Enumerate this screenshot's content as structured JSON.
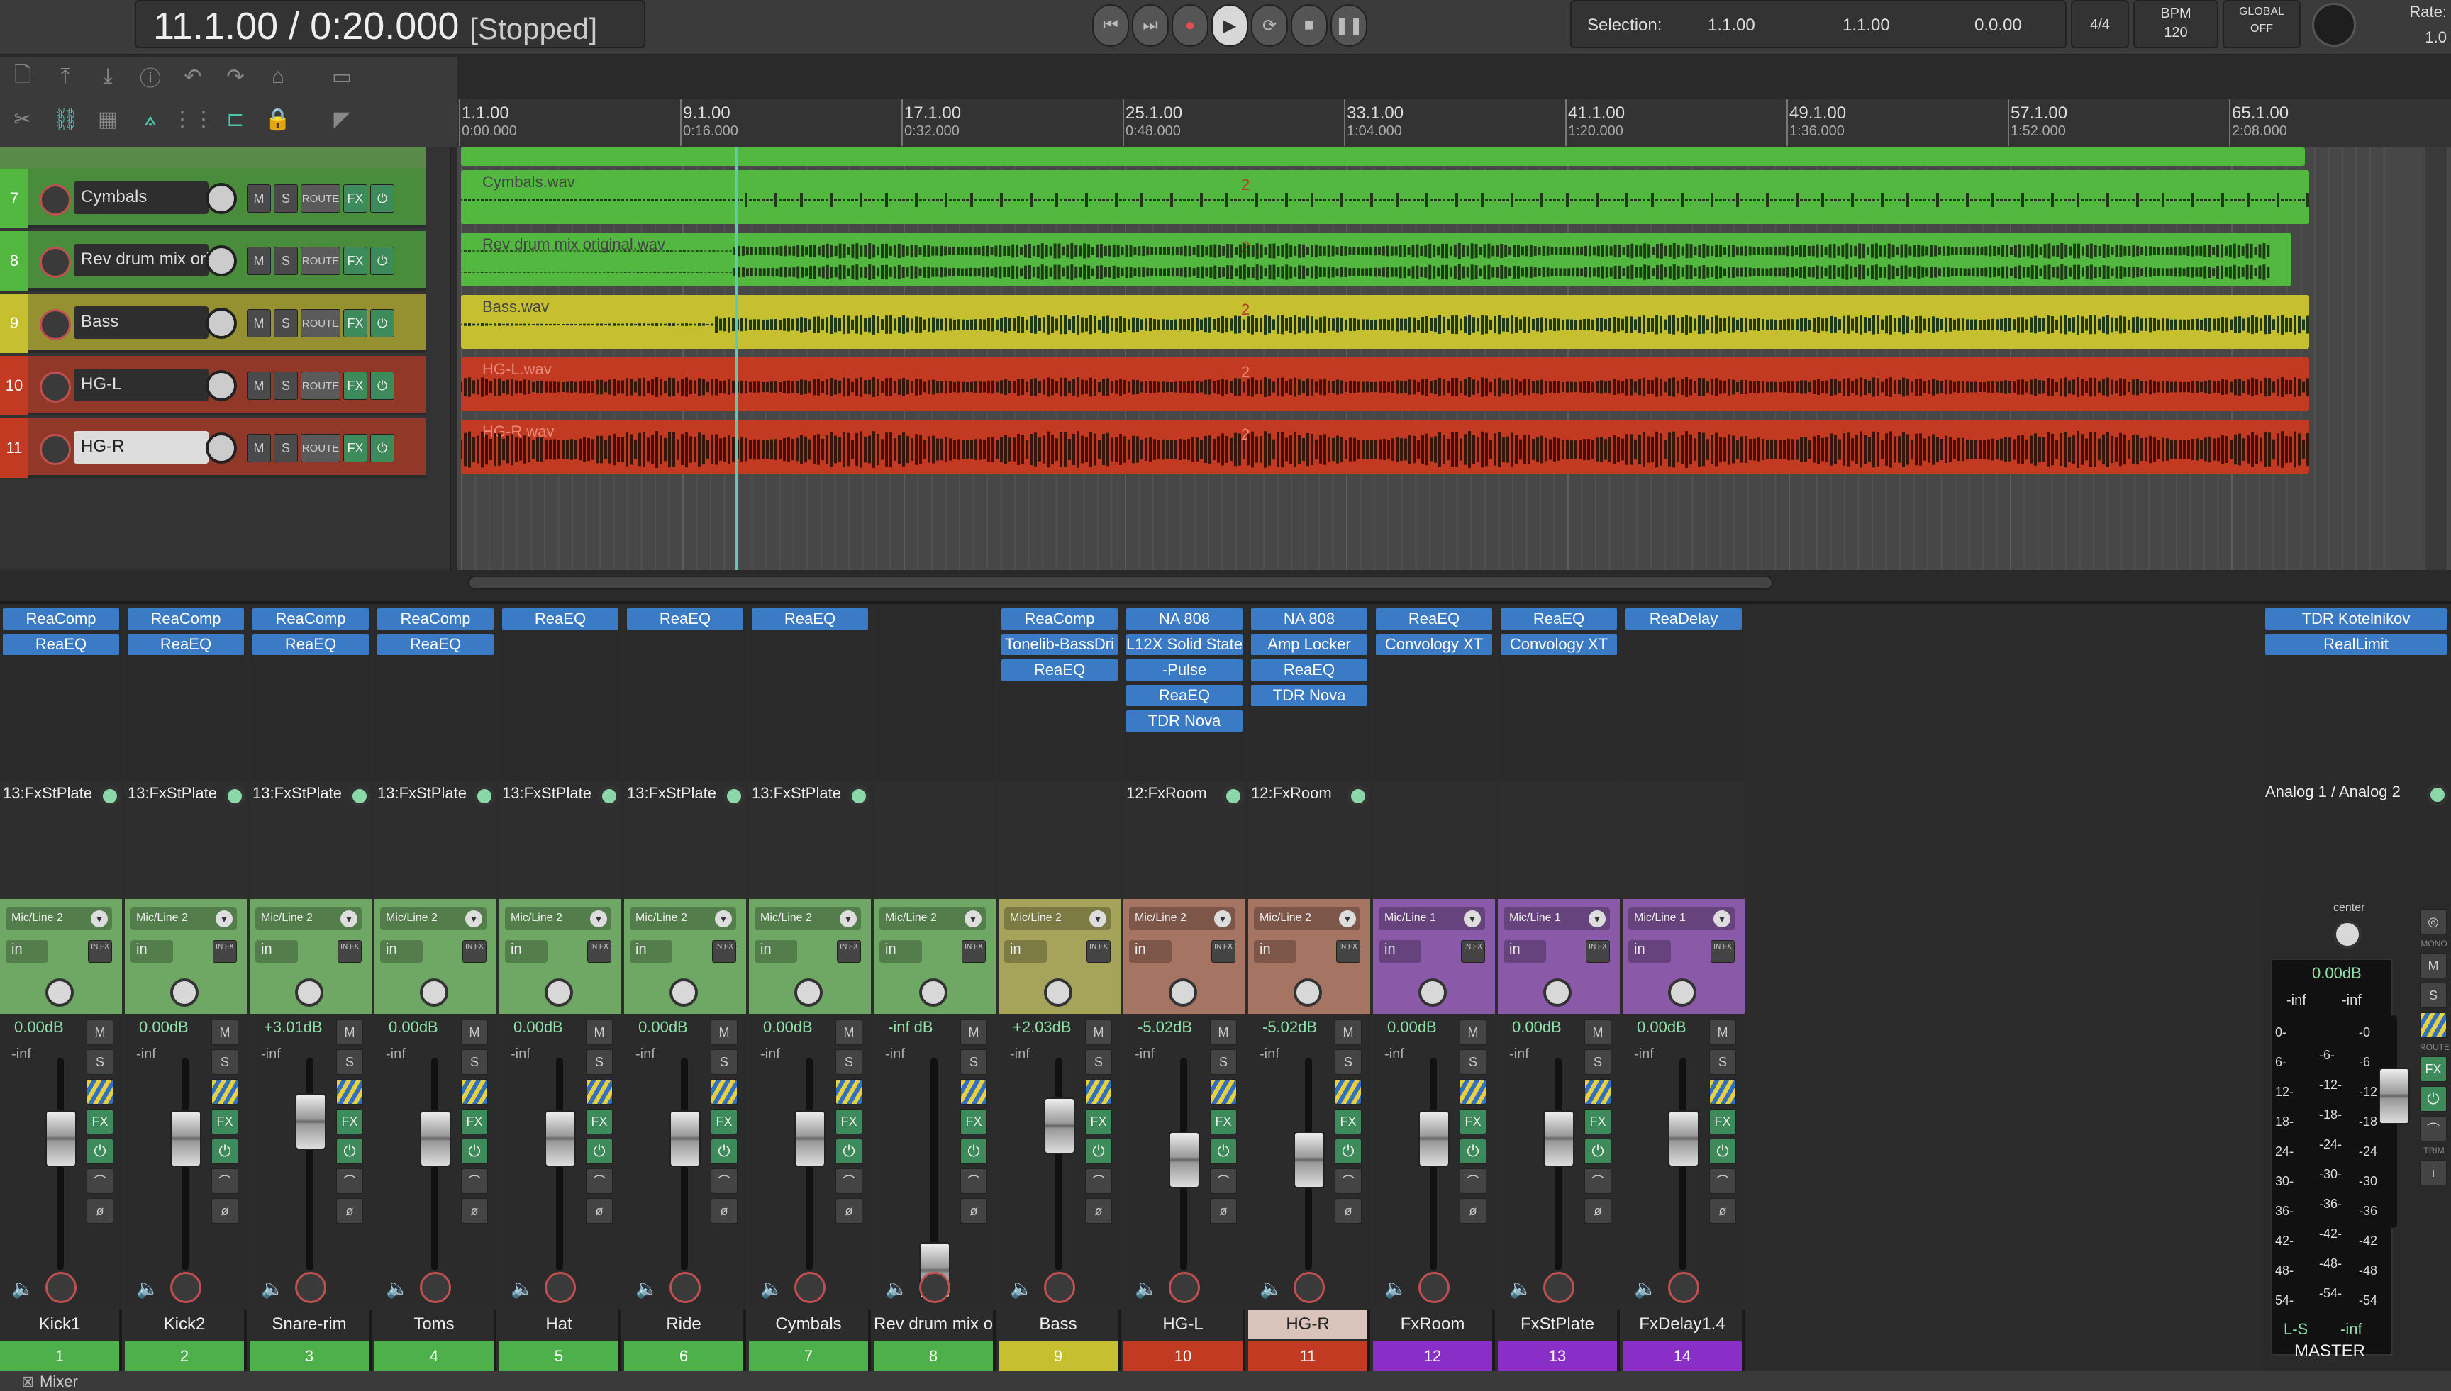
{
  "transport": {
    "position": "11.1.00 / 0:20.000",
    "state": "[Stopped]"
  },
  "selection": {
    "label": "Selection:",
    "start": "1.1.00",
    "end": "1.1.00",
    "length": "0.0.00"
  },
  "timesig": "4/4",
  "bpm": {
    "label": "BPM",
    "value": "120"
  },
  "global": {
    "label": "GLOBAL",
    "value": "OFF"
  },
  "rate": {
    "label": "Rate:",
    "value": "1.0"
  },
  "ruler": [
    {
      "bar": "1.1.00",
      "time": "0:00.000"
    },
    {
      "bar": "9.1.00",
      "time": "0:16.000"
    },
    {
      "bar": "17.1.00",
      "time": "0:32.000"
    },
    {
      "bar": "25.1.00",
      "time": "0:48.000"
    },
    {
      "bar": "33.1.00",
      "time": "1:04.000"
    },
    {
      "bar": "41.1.00",
      "time": "1:20.000"
    },
    {
      "bar": "49.1.00",
      "time": "1:36.000"
    },
    {
      "bar": "57.1.00",
      "time": "1:52.000"
    },
    {
      "bar": "65.1.00",
      "time": "2:08.000"
    }
  ],
  "tracks": [
    {
      "num": "7",
      "name": "Cymbals",
      "color": "#52b840",
      "item": "Cymbals.wav"
    },
    {
      "num": "8",
      "name": "Rev drum mix ori",
      "color": "#52b840",
      "item": "Rev drum mix original.wav"
    },
    {
      "num": "9",
      "name": "Bass",
      "color": "#c6c030",
      "item": "Bass.wav"
    },
    {
      "num": "10",
      "name": "HG-L",
      "color": "#c23a22",
      "item": "HG-L.wav"
    },
    {
      "num": "11",
      "name": "HG-R",
      "color": "#c23a22",
      "item": "HG-R.wav"
    }
  ],
  "track_buttons": {
    "mute": "M",
    "solo": "S",
    "route": "ROUTE",
    "fx": "FX",
    "power": "⏻"
  },
  "item_marker": "2",
  "mixer": {
    "label": "Mixer",
    "strip_buttons": {
      "mute": "M",
      "solo": "S",
      "fx": "FX",
      "in": "in",
      "infx": "IN FX"
    },
    "strips": [
      {
        "name": "Kick1",
        "num": "1",
        "color": "#4eb04a",
        "io_color": "#6fa864",
        "fx": [
          "ReaComp",
          "ReaEQ"
        ],
        "send": "13:FxStPlate",
        "input": "Mic/Line 2",
        "vol": "0.00dB",
        "peak": "-inf",
        "fader": 0.62
      },
      {
        "name": "Kick2",
        "num": "2",
        "color": "#4eb04a",
        "io_color": "#6fa864",
        "fx": [
          "ReaComp",
          "ReaEQ"
        ],
        "send": "13:FxStPlate",
        "input": "Mic/Line 2",
        "vol": "0.00dB",
        "peak": "-inf",
        "fader": 0.62
      },
      {
        "name": "Snare-rim",
        "num": "3",
        "color": "#4eb04a",
        "io_color": "#6fa864",
        "fx": [
          "ReaComp",
          "ReaEQ"
        ],
        "send": "13:FxStPlate",
        "input": "Mic/Line 2",
        "vol": "+3.01dB",
        "peak": "-inf",
        "fader": 0.7
      },
      {
        "name": "Toms",
        "num": "4",
        "color": "#4eb04a",
        "io_color": "#6fa864",
        "fx": [
          "ReaComp",
          "ReaEQ"
        ],
        "send": "13:FxStPlate",
        "input": "Mic/Line 2",
        "vol": "0.00dB",
        "peak": "-inf",
        "fader": 0.62
      },
      {
        "name": "Hat",
        "num": "5",
        "color": "#4eb04a",
        "io_color": "#6fa864",
        "fx": [
          "ReaEQ"
        ],
        "send": "13:FxStPlate",
        "input": "Mic/Line 2",
        "vol": "0.00dB",
        "peak": "-inf",
        "fader": 0.62
      },
      {
        "name": "Ride",
        "num": "6",
        "color": "#4eb04a",
        "io_color": "#6fa864",
        "fx": [
          "ReaEQ"
        ],
        "send": "13:FxStPlate",
        "input": "Mic/Line 2",
        "vol": "0.00dB",
        "peak": "-inf",
        "fader": 0.62
      },
      {
        "name": "Cymbals",
        "num": "7",
        "color": "#4eb04a",
        "io_color": "#6fa864",
        "fx": [
          "ReaEQ"
        ],
        "send": "13:FxStPlate",
        "input": "Mic/Line 2",
        "vol": "0.00dB",
        "peak": "-inf",
        "fader": 0.62
      },
      {
        "name": "Rev drum mix o",
        "num": "8",
        "color": "#4eb04a",
        "io_color": "#6fa864",
        "fx": [],
        "send": "",
        "input": "Mic/Line 2",
        "vol": "-inf dB",
        "peak": "-inf",
        "fader": 0.0
      },
      {
        "name": "Bass",
        "num": "9",
        "color": "#c6c030",
        "io_color": "#a6a45a",
        "fx": [
          "ReaComp",
          "Tonelib-BassDri",
          "ReaEQ"
        ],
        "send": "",
        "input": "Mic/Line 2",
        "vol": "+2.03dB",
        "peak": "-inf",
        "fader": 0.68
      },
      {
        "name": "HG-L",
        "num": "10",
        "color": "#c23a22",
        "io_color": "#a67462",
        "fx": [
          "NA 808",
          "L12X Solid State",
          "-Pulse",
          "ReaEQ",
          "TDR Nova"
        ],
        "send": "12:FxRoom",
        "input": "Mic/Line 2",
        "vol": "-5.02dB",
        "peak": "-inf",
        "fader": 0.52
      },
      {
        "name": "HG-R",
        "num": "11",
        "color": "#c23a22",
        "io_color": "#a67462",
        "fx": [
          "NA 808",
          "Amp Locker",
          "ReaEQ",
          "TDR Nova"
        ],
        "send": "12:FxRoom",
        "input": "Mic/Line 2",
        "vol": "-5.02dB",
        "peak": "-inf",
        "fader": 0.52,
        "selected": true
      },
      {
        "name": "FxRoom",
        "num": "12",
        "color": "#8a2ec8",
        "io_color": "#8a5aa8",
        "fx": [
          "ReaEQ",
          "Convology XT"
        ],
        "send": "",
        "input": "Mic/Line 1",
        "vol": "0.00dB",
        "peak": "-inf",
        "fader": 0.62
      },
      {
        "name": "FxStPlate",
        "num": "13",
        "color": "#8a2ec8",
        "io_color": "#8a5aa8",
        "fx": [
          "ReaEQ",
          "Convology XT"
        ],
        "send": "",
        "input": "Mic/Line 1",
        "vol": "0.00dB",
        "peak": "-inf",
        "fader": 0.62
      },
      {
        "name": "FxDelay1.4",
        "num": "14",
        "color": "#8a2ec8",
        "io_color": "#8a5aa8",
        "fx": [
          "ReaDelay"
        ],
        "send": "",
        "input": "Mic/Line 1",
        "vol": "0.00dB",
        "peak": "-inf",
        "fader": 0.62
      }
    ],
    "master": {
      "name": "MASTER",
      "fx": [
        "TDR Kotelnikov",
        "RealLimit"
      ],
      "output": "Analog 1 / Analog 2",
      "pan": "center",
      "vol": "0.00dB",
      "peakL": "-inf",
      "peakR": "-inf",
      "scale": [
        "0-",
        "6-",
        "12-",
        "18-",
        "24-",
        "30-",
        "36-",
        "42-",
        "48-",
        "54-"
      ],
      "scale2": [
        "-6-",
        "-12-",
        "-18-",
        "-24-",
        "-30-",
        "-36-",
        "-42-",
        "-48-",
        "-54-"
      ],
      "scale3": [
        "-0",
        "-6",
        "-12",
        "-18",
        "-24",
        "-30",
        "-36",
        "-42",
        "-48",
        "-54"
      ],
      "ls": "L-S",
      "ls_val": "-inf",
      "mono": "MONO",
      "route": "ROUTE",
      "trim": "TRIM",
      "fader": 0.62
    }
  }
}
